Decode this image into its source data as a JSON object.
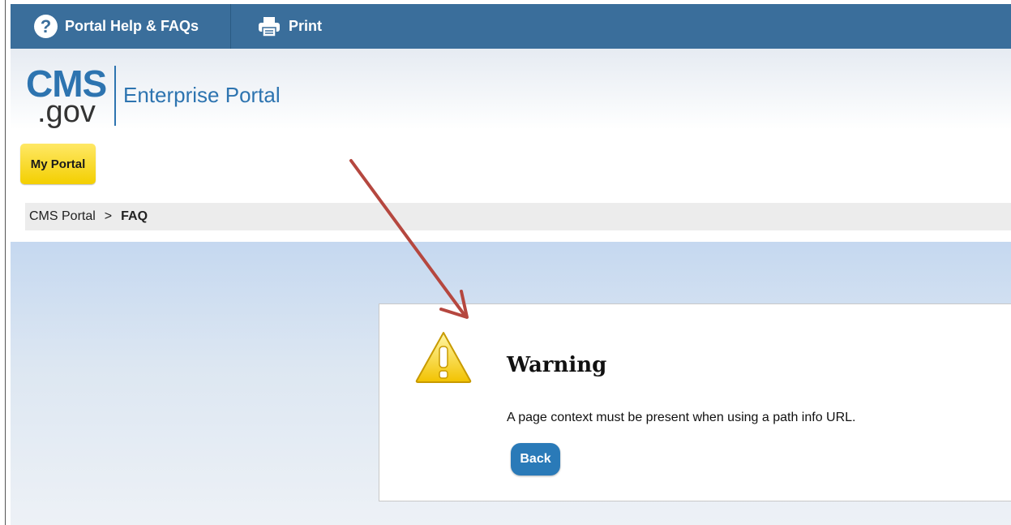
{
  "topbar": {
    "help_label": "Portal Help & FAQs",
    "help_icon": "question-circle-icon",
    "print_label": "Print",
    "print_icon": "printer-icon"
  },
  "header": {
    "logo_cms": "CMS",
    "logo_gov": ".gov",
    "portal_name": "Enterprise Portal"
  },
  "nav": {
    "my_portal": "My Portal"
  },
  "breadcrumb": {
    "items": [
      "CMS Portal",
      "FAQ"
    ],
    "separator": ">"
  },
  "warning": {
    "icon": "warning-triangle-icon",
    "title": "Warning",
    "message": "A page context must be present when using a path info URL.",
    "back_label": "Back"
  },
  "colors": {
    "topbar": "#3a6e9b",
    "brand_blue": "#2d74b0",
    "my_portal_yellow": "#f3cf00",
    "back_button": "#2a7ab8",
    "annotation_arrow": "#b5473f"
  }
}
